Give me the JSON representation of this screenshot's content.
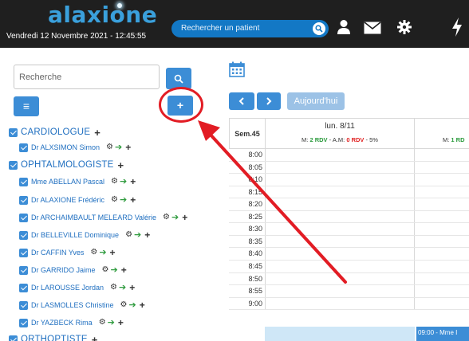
{
  "header": {
    "logo_text": "alaxione",
    "datetime": "Vendredi 12 Novembre 2021 - 12:45:55",
    "search_placeholder": "Rechercher un patient",
    "icons": [
      "user-icon",
      "mail-icon",
      "gear-icon",
      "lightning-icon"
    ]
  },
  "sidebar": {
    "search_placeholder": "Recherche",
    "buttons": {
      "menu": "≡",
      "add": "+"
    },
    "tree": [
      {
        "category": "CARDIOLOGUE",
        "doctors": [
          "Dr ALXSIMON Simon"
        ]
      },
      {
        "category": "OPHTALMOLOGISTE",
        "doctors": [
          "Mme ABELLAN Pascal",
          "Dr ALAXIONE Frédéric",
          "Dr ARCHAIMBAULT MELEARD Valérie",
          "Dr BELLEVILLE Dominique",
          "Dr CAFFIN Yves",
          "Dr GARRIDO Jaime",
          "Dr LAROUSSE Jordan",
          "Dr LASMOLLES Christine",
          "Dr YAZBECK Rima"
        ]
      },
      {
        "category": "ORTHOPTISTE",
        "doctors": []
      }
    ]
  },
  "calendar": {
    "today_label": "Aujourd'hui",
    "week_label": "Sem.45",
    "day1": {
      "date": "lun. 8/11",
      "stats_prefix": "M: ",
      "rdv1": "2 RDV",
      "mid": " - A.M: ",
      "rdv2": "0 RDV",
      "suffix": " - 5%"
    },
    "day2": {
      "stats_prefix": "M: ",
      "rdv1": "1 RD"
    },
    "times": [
      "8:00",
      "8:05",
      "8:10",
      "8:15",
      "8:20",
      "8:25",
      "8:30",
      "8:35",
      "8:40",
      "8:45",
      "8:50",
      "8:55",
      "9:00"
    ],
    "appointment_text": "09:00 - Mme I"
  },
  "colors": {
    "accent": "#3c8dd6",
    "annotation": "#e21c24",
    "header_bg": "#1f1f1f",
    "link": "#1f6fc0"
  }
}
